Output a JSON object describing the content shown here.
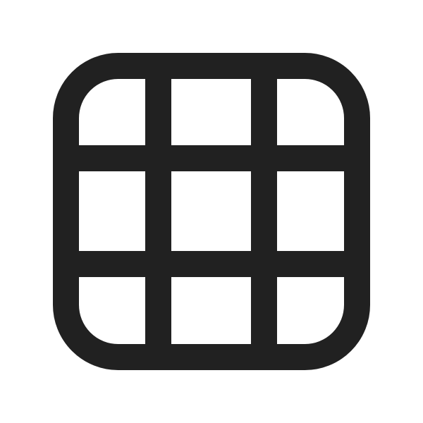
{
  "icon": {
    "name": "grid-3x3-icon",
    "color": "#212121",
    "background": "#ffffff"
  }
}
